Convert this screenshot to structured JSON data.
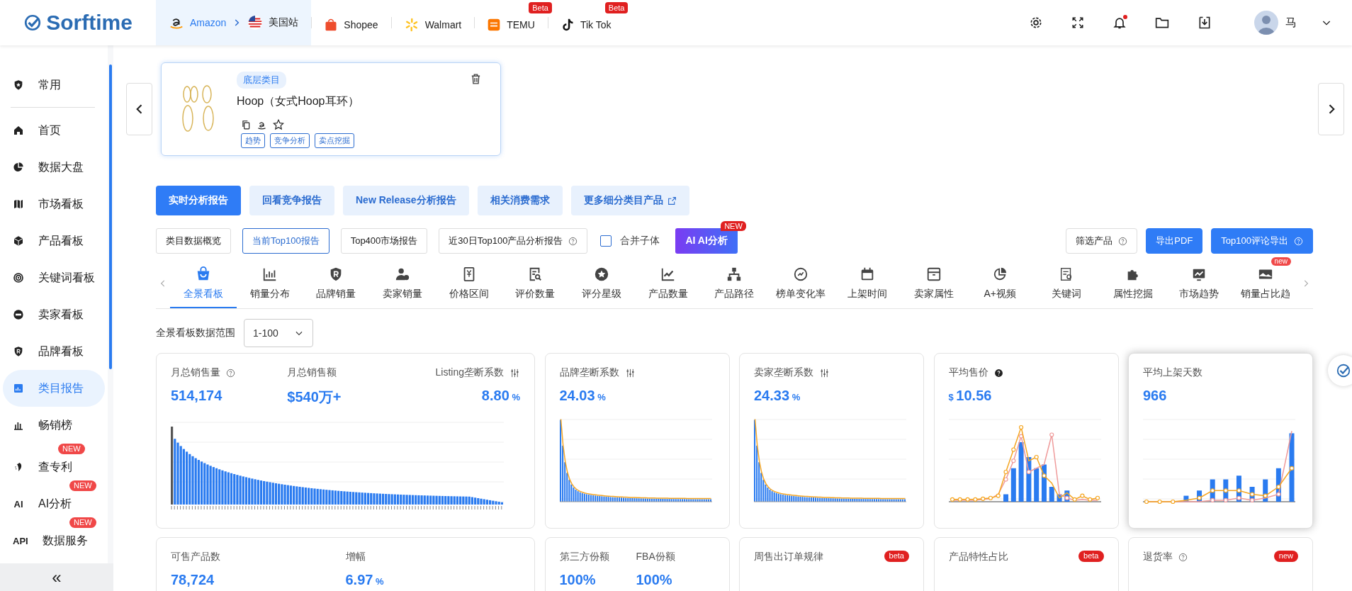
{
  "header": {
    "logo": "Sorftime",
    "platforms": [
      {
        "label": "Amazon",
        "selected": true,
        "region": "美国站"
      },
      {
        "label": "Shopee",
        "selected": false
      },
      {
        "label": "Walmart",
        "selected": false
      },
      {
        "label": "TEMU",
        "selected": false,
        "badge": "Beta"
      },
      {
        "label": "Tik Tok",
        "selected": false,
        "badge": "Beta"
      }
    ],
    "notification_dot": true,
    "user": {
      "name": "马"
    }
  },
  "sidebar": {
    "items": [
      {
        "label": "常用",
        "selected": false
      },
      {
        "label": "首页",
        "selected": false
      },
      {
        "label": "数据大盘",
        "selected": false
      },
      {
        "label": "市场看板",
        "selected": false
      },
      {
        "label": "产品看板",
        "selected": false
      },
      {
        "label": "关键词看板",
        "selected": false
      },
      {
        "label": "卖家看板",
        "selected": false
      },
      {
        "label": "品牌看板",
        "selected": false
      },
      {
        "label": "类目报告",
        "selected": true
      },
      {
        "label": "畅销榜",
        "selected": false
      },
      {
        "label": "查专利",
        "selected": false,
        "badge": "NEW"
      },
      {
        "label": "AI分析",
        "selected": false,
        "badge": "NEW",
        "icon_text": "AI"
      },
      {
        "label": "数据服务",
        "selected": false,
        "badge": "NEW",
        "icon_text": "API"
      }
    ],
    "collapse": "«"
  },
  "category_card": {
    "tag": "底层类目",
    "title": "Hoop（女式Hoop耳环）",
    "favorited": false,
    "links": [
      "趋势",
      "竞争分析",
      "卖点挖掘"
    ]
  },
  "action_buttons": [
    {
      "label": "实时分析报告",
      "selected": true
    },
    {
      "label": "回看竞争报告",
      "selected": false
    },
    {
      "label": "New Release分析报告",
      "selected": false
    },
    {
      "label": "相关消费需求",
      "selected": false
    },
    {
      "label": "更多细分类目产品",
      "selected": false,
      "external": true
    }
  ],
  "report_tabs": [
    {
      "label": "类目数据概览",
      "selected": false
    },
    {
      "label": "当前Top100报告",
      "selected": true
    },
    {
      "label": "Top400市场报告",
      "selected": false
    },
    {
      "label": "近30日Top100产品分析报告",
      "selected": false,
      "help": true
    }
  ],
  "merge_checkbox": {
    "label": "合并子体",
    "checked": false
  },
  "ai_button": {
    "icon_text": "AI",
    "label": "AI分析",
    "badge": "NEW"
  },
  "tool_buttons": [
    {
      "label": "筛选产品",
      "kind": "outline",
      "help": true
    },
    {
      "label": "导出PDF",
      "kind": "primary"
    },
    {
      "label": "Top100评论导出",
      "kind": "primary",
      "help": true
    }
  ],
  "view_tabs": [
    {
      "label": "全景看板",
      "selected": true
    },
    {
      "label": "销量分布",
      "selected": false
    },
    {
      "label": "品牌销量",
      "selected": false
    },
    {
      "label": "卖家销量",
      "selected": false
    },
    {
      "label": "价格区间",
      "selected": false
    },
    {
      "label": "评价数量",
      "selected": false
    },
    {
      "label": "评分星级",
      "selected": false
    },
    {
      "label": "产品数量",
      "selected": false
    },
    {
      "label": "产品路径",
      "selected": false
    },
    {
      "label": "榜单变化率",
      "selected": false
    },
    {
      "label": "上架时间",
      "selected": false
    },
    {
      "label": "卖家属性",
      "selected": false
    },
    {
      "label": "A+视频",
      "selected": false
    },
    {
      "label": "关键词",
      "selected": false
    },
    {
      "label": "属性挖掘",
      "selected": false
    },
    {
      "label": "市场趋势",
      "selected": false
    },
    {
      "label": "销量占比趋",
      "selected": false,
      "badge": "new"
    }
  ],
  "range": {
    "label": "全景看板数据范围",
    "value": "1-100"
  },
  "cards": [
    {
      "highlighted": false,
      "kind": "bars",
      "metrics": [
        {
          "label": "月总销售量",
          "kind": "help",
          "value": "514,174"
        },
        {
          "label": "月总销售额",
          "kind": "plain",
          "value": "$540万+"
        },
        {
          "label": "Listing垄断系数",
          "kind": "sliders",
          "value": "8.80",
          "unit": "%"
        }
      ]
    },
    {
      "highlighted": false,
      "kind": "decay",
      "metrics": [
        {
          "label": "品牌垄断系数",
          "kind": "sliders",
          "value": "24.03",
          "unit": "%"
        }
      ]
    },
    {
      "highlighted": false,
      "kind": "decay",
      "metrics": [
        {
          "label": "卖家垄断系数",
          "kind": "sliders",
          "value": "24.33",
          "unit": "%"
        }
      ]
    },
    {
      "highlighted": false,
      "kind": "combo",
      "metrics": [
        {
          "label": "平均售价",
          "kind": "info",
          "prefix": "$",
          "value": "10.56"
        }
      ]
    },
    {
      "highlighted": true,
      "kind": "growth",
      "metrics": [
        {
          "label": "平均上架天数",
          "kind": "plain",
          "value": "966"
        }
      ]
    },
    {
      "highlighted": false,
      "metrics": [
        {
          "label": "可售产品数",
          "value": "78,724"
        },
        {
          "label": "增幅",
          "value": "6.97",
          "unit": "%"
        }
      ]
    },
    {
      "highlighted": false,
      "metrics": [
        {
          "label": "第三方份额",
          "value": "100%"
        },
        {
          "label": "FBA份额",
          "value": "100%"
        }
      ]
    },
    {
      "highlighted": false,
      "badge": "beta",
      "metrics": [
        {
          "label": "周售出订单规律"
        }
      ]
    },
    {
      "highlighted": false,
      "badge": "beta",
      "metrics": [
        {
          "label": "产品特性占比"
        }
      ]
    },
    {
      "highlighted": false,
      "badge": "new",
      "metrics": [
        {
          "label": "退货率",
          "kind": "help"
        }
      ]
    }
  ]
}
